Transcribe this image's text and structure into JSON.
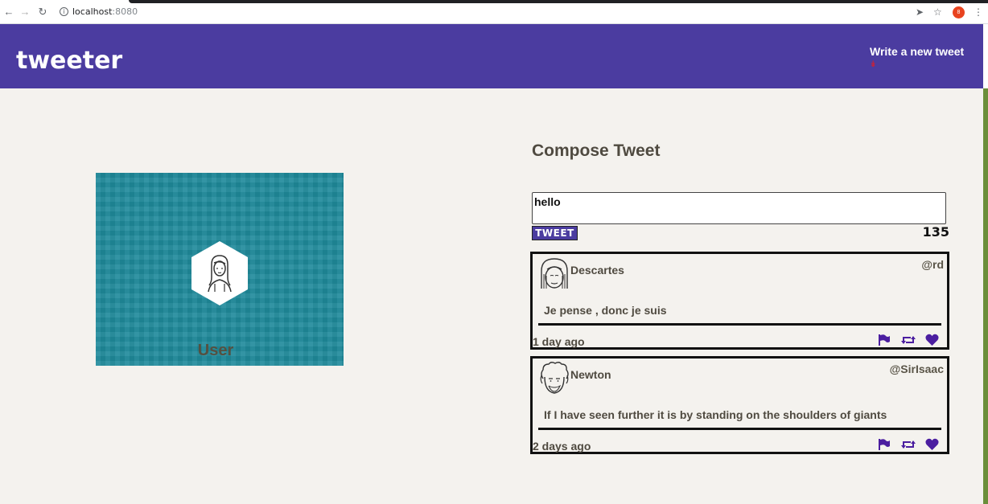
{
  "browser": {
    "url_host": "localhost",
    "url_port": ":8080",
    "profile_initial": "8"
  },
  "header": {
    "brand": "tweeter",
    "write_link": "Write a new tweet"
  },
  "profile": {
    "name": "User"
  },
  "compose": {
    "title": "Compose Tweet",
    "input_value": "hello",
    "button_label": "TWEET",
    "counter": "135"
  },
  "tweets": [
    {
      "name": "Descartes",
      "handle": "@rd",
      "content": "Je pense , donc je suis",
      "time": "1 day ago"
    },
    {
      "name": "Newton",
      "handle": "@SirIsaac",
      "content": "If I have seen further it is by standing on the shoulders of giants",
      "time": "2 days ago"
    }
  ],
  "colors": {
    "header_bg": "#4b3ca0",
    "action_icons": "#4b1ea0",
    "profile_bg": "#1f8a9b",
    "page_bg": "#f4f2ee"
  },
  "icons": [
    "back-icon",
    "forward-icon",
    "reload-icon",
    "info-icon",
    "send-icon",
    "star-icon",
    "menu-icon",
    "flag-icon",
    "retweet-icon",
    "heart-icon",
    "chevron-down-icon"
  ]
}
